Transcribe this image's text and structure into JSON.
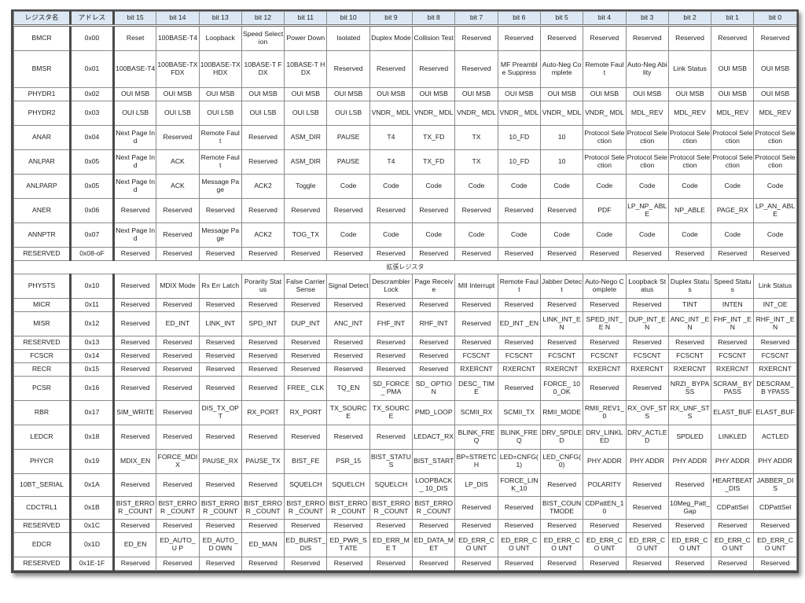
{
  "header": {
    "name": "レジスタ名",
    "address": "アドレス",
    "bits": [
      "bit 15",
      "bit 14",
      "bit 13",
      "bit 12",
      "bit 11",
      "bit 10",
      "bit 9",
      "bit 8",
      "bit 7",
      "bit 6",
      "bit 5",
      "bit 4",
      "bit 3",
      "bit 2",
      "bit 1",
      "bit 0"
    ]
  },
  "section_label": "拡張レジスタ",
  "basic_registers": [
    {
      "name": "BMCR",
      "address": "0x00",
      "h": "h2",
      "bits": [
        "Reset",
        "100BASE-T4",
        "Loopback",
        "Speed Selection",
        "Power Down",
        "Isolated",
        "Duplex Mode",
        "Collision Test",
        "Reserved",
        "Reserved",
        "Reserved",
        "Reserved",
        "Reserved",
        "Reserved",
        "Reserved",
        "Reserved"
      ]
    },
    {
      "name": "BMSR",
      "address": "0x01",
      "h": "h3",
      "bits": [
        "100BASE-T4",
        "100BASE-TX FDX",
        "100BASE-TX HDX",
        "10BASE-T FDX",
        "10BASE-T HDX",
        "Reserved",
        "Reserved",
        "Reserved",
        "Reserved",
        "MF Preamble Suppress",
        "Auto-Neg Complete",
        "Remote Fault",
        "Auto-Neg Ability",
        "Link Status",
        "OUI MSB",
        "OUI MSB"
      ]
    },
    {
      "name": "PHYDR1",
      "address": "0x02",
      "h": "h1",
      "bits": [
        "OUI MSB",
        "OUI MSB",
        "OUI MSB",
        "OUI MSB",
        "OUI MSB",
        "OUI MSB",
        "OUI MSB",
        "OUI MSB",
        "OUI MSB",
        "OUI MSB",
        "OUI MSB",
        "OUI MSB",
        "OUI MSB",
        "OUI MSB",
        "OUI MSB",
        "OUI MSB"
      ]
    },
    {
      "name": "PHYDR2",
      "address": "0x03",
      "h": "h2",
      "bits": [
        "OUI LSB",
        "OUI LSB",
        "OUI LSB",
        "OUI LSB",
        "OUI LSB",
        "OUI LSB",
        "VNDR_ MDL",
        "VNDR_ MDL",
        "VNDR_ MDL",
        "VNDR_ MDL",
        "VNDR_ MDL",
        "VNDR_ MDL",
        "MDL_REV",
        "MDL_REV",
        "MDL_REV",
        "MDL_REV"
      ]
    },
    {
      "name": "ANAR",
      "address": "0x04",
      "h": "h2",
      "bits": [
        "Next Page Ind",
        "Reserved",
        "Remote Fault",
        "Reserved",
        "ASM_DIR",
        "PAUSE",
        "T4",
        "TX_FD",
        "TX",
        "10_FD",
        "10",
        "Protocol Selection",
        "Protocol Selection",
        "Protocol Selection",
        "Protocol Selection",
        "Protocol Selection"
      ]
    },
    {
      "name": "ANLPAR",
      "address": "0x05",
      "h": "h2",
      "bits": [
        "Next Page Ind",
        "ACK",
        "Remote Fault",
        "Reserved",
        "ASM_DIR",
        "PAUSE",
        "T4",
        "TX_FD",
        "TX",
        "10_FD",
        "10",
        "Protocol Selection",
        "Protocol Selection",
        "Protocol Selection",
        "Protocol Selection",
        "Protocol Selection"
      ]
    },
    {
      "name": "ANLPARP",
      "address": "0x05",
      "h": "h2",
      "bits": [
        "Next Page Ind",
        "ACK",
        "Message Page",
        "ACK2",
        "Toggle",
        "Code",
        "Code",
        "Code",
        "Code",
        "Code",
        "Code",
        "Code",
        "Code",
        "Code",
        "Code",
        "Code"
      ]
    },
    {
      "name": "ANER",
      "address": "0x06",
      "h": "h2",
      "bits": [
        "Reserved",
        "Reserved",
        "Reserved",
        "Reserved",
        "Reserved",
        "Reserved",
        "Reserved",
        "Reserved",
        "Reserved",
        "Reserved",
        "Reserved",
        "PDF",
        "LP_NP_ ABLE",
        "NP_ABLE",
        "PAGE_RX",
        "LP_AN_ ABLE"
      ]
    },
    {
      "name": "ANNPTR",
      "address": "0x07",
      "h": "h2",
      "bits": [
        "Next Page Ind",
        "Reserved",
        "Message Page",
        "ACK2",
        "TOG_TX",
        "Code",
        "Code",
        "Code",
        "Code",
        "Code",
        "Code",
        "Code",
        "Code",
        "Code",
        "Code",
        "Code"
      ]
    },
    {
      "name": "RESERVED",
      "address": "0x08-oF",
      "h": "h1",
      "bits": [
        "Reserved",
        "Reserved",
        "Reserved",
        "Reserved",
        "Reserved",
        "Reserved",
        "Reserved",
        "Reserved",
        "Reserved",
        "Reserved",
        "Reserved",
        "Reserved",
        "Reserved",
        "Reserved",
        "Reserved",
        "Reserved"
      ]
    }
  ],
  "extended_registers": [
    {
      "name": "PHYSTS",
      "address": "0x10",
      "h": "h2",
      "bits": [
        "Reserved",
        "MDIX Mode",
        "Rx Err Latch",
        "Porarity Status",
        "False Carrier Sense",
        "Signal Detect",
        "Descrambler Lock",
        "Page Receive",
        "MII Interrupt",
        "Remote Fault",
        "Jabber Detect",
        "Auto-Nego Complete",
        "Loopback Status",
        "Duplex Status",
        "Speed Status",
        "Link Status"
      ]
    },
    {
      "name": "MICR",
      "address": "0x11",
      "h": "h1",
      "bits": [
        "Reserved",
        "Reserved",
        "Reserved",
        "Reserved",
        "Reserved",
        "Reserved",
        "Reserved",
        "Reserved",
        "Reserved",
        "Reserved",
        "Reserved",
        "Reserved",
        "Reserved",
        "TINT",
        "INTEN",
        "INT_OE"
      ]
    },
    {
      "name": "MISR",
      "address": "0x12",
      "h": "h2",
      "bits": [
        "Reserved",
        "ED_INT",
        "LINK_INT",
        "SPD_INT",
        "DUP_INT",
        "ANC_INT",
        "FHF_INT",
        "RHF_INT",
        "Reserved",
        "ED_INT _EN",
        "LINK_INT_E N",
        "SPED_INT_E N",
        "DUP_INT_E N",
        "ANC_INT _EN",
        "FHF_INT _EN",
        "RHF_INT _EN"
      ]
    },
    {
      "name": "RESERVED",
      "address": "0x13",
      "h": "h1",
      "bits": [
        "Reserved",
        "Reserved",
        "Reserved",
        "Reserved",
        "Reserved",
        "Reserved",
        "Reserved",
        "Reserved",
        "Reserved",
        "Reserved",
        "Reserved",
        "Reserved",
        "Reserved",
        "Reserved",
        "Reserved",
        "Reserved"
      ]
    },
    {
      "name": "FCSCR",
      "address": "0x14",
      "h": "h1",
      "bits": [
        "Reserved",
        "Reserved",
        "Reserved",
        "Reserved",
        "Reserved",
        "Reserved",
        "Reserved",
        "Reserved",
        "FCSCNT",
        "FCSCNT",
        "FCSCNT",
        "FCSCNT",
        "FCSCNT",
        "FCSCNT",
        "FCSCNT",
        "FCSCNT"
      ]
    },
    {
      "name": "RECR",
      "address": "0x15",
      "h": "h1",
      "bits": [
        "Reserved",
        "Reserved",
        "Reserved",
        "Reserved",
        "Reserved",
        "Reserved",
        "Reserved",
        "Reserved",
        "RXERCNT",
        "RXERCNT",
        "RXERCNT",
        "RXERCNT",
        "RXERCNT",
        "RXERCNT",
        "RXERCNT",
        "RXERCNT"
      ]
    },
    {
      "name": "PCSR",
      "address": "0x16",
      "h": "h2",
      "bits": [
        "Reserved",
        "Reserved",
        "Reserved",
        "Reserved",
        "FREE_ CLK",
        "TQ_EN",
        "SD_FORCE_ PMA",
        "SD_ OPTION",
        "DESC_ TIME",
        "Reserved",
        "FORCE_ 100_OK",
        "Reserved",
        "Reserved",
        "NRZI_ BYPASS",
        "SCRAM_ BYPASS",
        "DESCRAM_B YPASS"
      ]
    },
    {
      "name": "RBR",
      "address": "0x17",
      "h": "h2",
      "bits": [
        "SIM_WRITE",
        "Reserved",
        "DIS_TX_OPT",
        "RX_PORT",
        "RX_PORT",
        "TX_SOURCE",
        "TX_SOURCE",
        "PMD_LOOP",
        "SCMII_RX",
        "SCMII_TX",
        "RMII_MODE",
        "RMII_REV1_ 0",
        "RX_OVF_ST S",
        "RX_UNF_ST S",
        "ELAST_BUF",
        "ELAST_BUF"
      ]
    },
    {
      "name": "LEDCR",
      "address": "0x18",
      "h": "h2",
      "bits": [
        "Reserved",
        "Reserved",
        "Reserved",
        "Reserved",
        "Reserved",
        "Reserved",
        "Reserved",
        "LEDACT_RX",
        "BLINK_FRE Q",
        "BLINK_FRE Q",
        "DRV_SPDLE D",
        "DRV_LINKL ED",
        "DRV_ACTLE D",
        "SPDLED",
        "LINKLED",
        "ACTLED"
      ]
    },
    {
      "name": "PHYCR",
      "address": "0x19",
      "h": "h2",
      "bits": [
        "MDIX_EN",
        "FORCE_MDI X",
        "PAUSE_RX",
        "PAUSE_TX",
        "BIST_FE",
        "PSR_15",
        "BIST_STATU S",
        "BIST_START",
        "BP=STRETC H",
        "LED=CNFG( 1)",
        "LED_CNFG( 0)",
        "PHY ADDR",
        "PHY ADDR",
        "PHY ADDR",
        "PHY ADDR",
        "PHY ADDR"
      ]
    },
    {
      "name": "10BT_SERIAL",
      "address": "0x1A",
      "h": "h28",
      "bits": [
        "Reserved",
        "Reserved",
        "Reserved",
        "Reserved",
        "SQUELCH",
        "SQUELCH",
        "SQUELCH",
        "LOOPBACK_ 10_DIS",
        "LP_DIS",
        "FORCE_LIN K_10",
        "Reserved",
        "POLARITY",
        "Reserved",
        "Reserved",
        "HEARTBEAT _DIS",
        "JABBER_DIS"
      ]
    },
    {
      "name": "CDCTRL1",
      "address": "0x1B",
      "h": "h28",
      "bits": [
        "BIST_ERROR _COUNT",
        "BIST_ERROR _COUNT",
        "BIST_ERROR _COUNT",
        "BIST_ERROR _COUNT",
        "BIST_ERROR _COUNT",
        "BIST_ERROR _COUNT",
        "BIST_ERROR _COUNT",
        "BIST_ERROR _COUNT",
        "Reserved",
        "Reserved",
        "BIST_COUN TMODE",
        "CDPattEN_1 0",
        "Reserved",
        "10Meg_Patt_ Gap",
        "CDPattSel",
        "CDPattSel"
      ]
    },
    {
      "name": "RESERVED",
      "address": "0x1C",
      "h": "h1",
      "bits": [
        "Reserved",
        "Reserved",
        "Reserved",
        "Reserved",
        "Reserved",
        "Reserved",
        "Reserved",
        "Reserved",
        "Reserved",
        "Reserved",
        "Reserved",
        "Reserved",
        "Reserved",
        "Reserved",
        "Reserved",
        "Reserved"
      ]
    },
    {
      "name": "EDCR",
      "address": "0x1D",
      "h": "h2",
      "bits": [
        "ED_EN",
        "ED_AUTO_U P",
        "ED_AUTO_D OWN",
        "ED_MAN",
        "ED_BURST_ DIS",
        "ED_PWR_ST ATE",
        "ED_ERR_ME T",
        "ED_DATA_M ET",
        "ED_ERR_CO UNT",
        "ED_ERR_CO UNT",
        "ED_ERR_CO UNT",
        "ED_ERR_CO UNT",
        "ED_ERR_CO UNT",
        "ED_ERR_CO UNT",
        "ED_ERR_CO UNT",
        "ED_ERR_CO UNT"
      ]
    },
    {
      "name": "RESERVED",
      "address": "0x1E-1F",
      "h": "h1",
      "bits": [
        "Reserved",
        "Reserved",
        "Reserved",
        "Reserved",
        "Reserved",
        "Reserved",
        "Reserved",
        "Reserved",
        "Reserved",
        "Reserved",
        "Reserved",
        "Reserved",
        "Reserved",
        "Reserved",
        "Reserved",
        "Reserved"
      ]
    }
  ],
  "colors": {
    "header_bg": "#dbe8f4",
    "frame_border": "#4a4a4a",
    "grid_line": "#8a8a8a"
  }
}
